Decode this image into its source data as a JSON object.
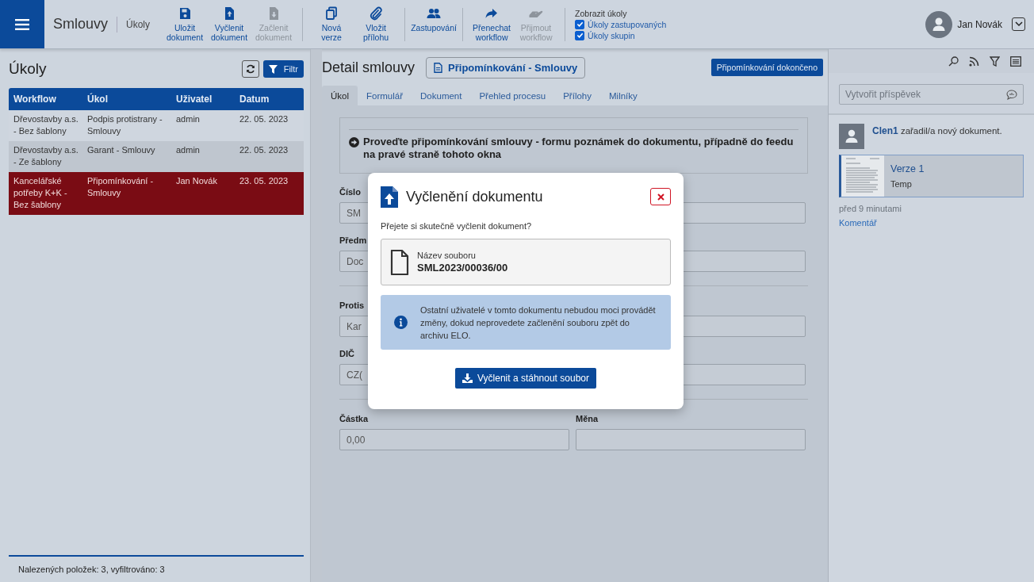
{
  "app": {
    "title": "Smlouvy",
    "section": "Úkoly"
  },
  "toolbar": [
    [
      {
        "label": "Uložit dokument",
        "disabled": false
      },
      {
        "label": "Vyčlenit dokument",
        "disabled": false
      },
      {
        "label": "Začlenit dokument",
        "disabled": true
      }
    ],
    [
      {
        "label": "Nová verze",
        "disabled": false
      },
      {
        "label": "Vložit přílohu",
        "disabled": false
      }
    ],
    [
      {
        "label": "Zastupování",
        "disabled": false
      }
    ],
    [
      {
        "label": "Přenechat workflow",
        "disabled": false
      },
      {
        "label": "Přijmout workflow",
        "disabled": true
      }
    ]
  ],
  "show_tasks": {
    "title": "Zobrazit úkoly",
    "options": [
      {
        "label": "Úkoly zastupovaných",
        "checked": true
      },
      {
        "label": "Úkoly skupin",
        "checked": true
      }
    ]
  },
  "user": {
    "name": "Jan Novák"
  },
  "tasks_panel": {
    "title": "Úkoly",
    "filter_button": "Filtr",
    "columns": [
      "Workflow",
      "Úkol",
      "Uživatel",
      "Datum"
    ],
    "rows": [
      {
        "cells": [
          "Dřevostavby a.s. - Bez šablony",
          "Podpis protistrany - Smlouvy",
          "admin",
          "22. 05. 2023"
        ],
        "selected": false
      },
      {
        "cells": [
          "Dřevostavby a.s. - Ze šablony",
          "Garant - Smlouvy",
          "admin",
          "22. 05. 2023"
        ],
        "selected": false
      },
      {
        "cells": [
          "Kancelářské potřeby K+K - Bez šablony",
          "Připomínkování - Smlouvy",
          "Jan Novák",
          "23. 05. 2023"
        ],
        "selected": true
      }
    ],
    "status": "Nalezených položek: 3, vyfiltrováno: 3"
  },
  "detail": {
    "title": "Detail smlouvy",
    "task_badge": "Připomínkování - Smlouvy",
    "complete_button": "Připomínkování dokončeno",
    "tabs": [
      {
        "label": "Úkol",
        "selected": true
      },
      {
        "label": "Formulář",
        "selected": false
      },
      {
        "label": "Dokument",
        "selected": false
      },
      {
        "label": "Přehled procesu",
        "selected": false
      },
      {
        "label": "Přílohy",
        "selected": false
      },
      {
        "label": "Milníky",
        "selected": false
      }
    ],
    "instruction": "Proveďte připomínkování smlouvy - formu poznámek do dokumentu, případně do feedu na pravé straně tohoto okna",
    "sections": [
      [
        {
          "left": {
            "label": "Číslo",
            "value": "SM"
          }
        },
        {
          "left": {
            "label": "Předm",
            "value": "Doc"
          }
        }
      ],
      [
        {
          "left": {
            "label": "Protis",
            "value": "Kar"
          }
        },
        {
          "left": {
            "label": "DIČ",
            "value": "CZ("
          }
        }
      ],
      [
        {
          "left": {
            "label": "Částka",
            "value": "0,00"
          },
          "right": {
            "label": "Měna"
          }
        }
      ]
    ]
  },
  "feed": {
    "placeholder": "Vytvořit příspěvek",
    "posts": [
      {
        "author": "Clen1",
        "text": "zařadil/a nový dokument.",
        "doc_title": "Verze 1",
        "doc_subtitle": "Temp",
        "time": "před 9 minutami",
        "comment": "Komentář"
      }
    ]
  },
  "modal": {
    "title": "Vyčlenění dokumentu",
    "question": "Přejete si skutečně vyčlenit dokument?",
    "file_label": "Název souboru",
    "file_name": "SML2023/00036/00",
    "info": "Ostatní uživatelé v tomto dokumentu nebudou moci provádět změny, dokud neprovedete začlenění souboru zpět do archivu ELO.",
    "button": "Vyčlenit a stáhnout soubor"
  }
}
